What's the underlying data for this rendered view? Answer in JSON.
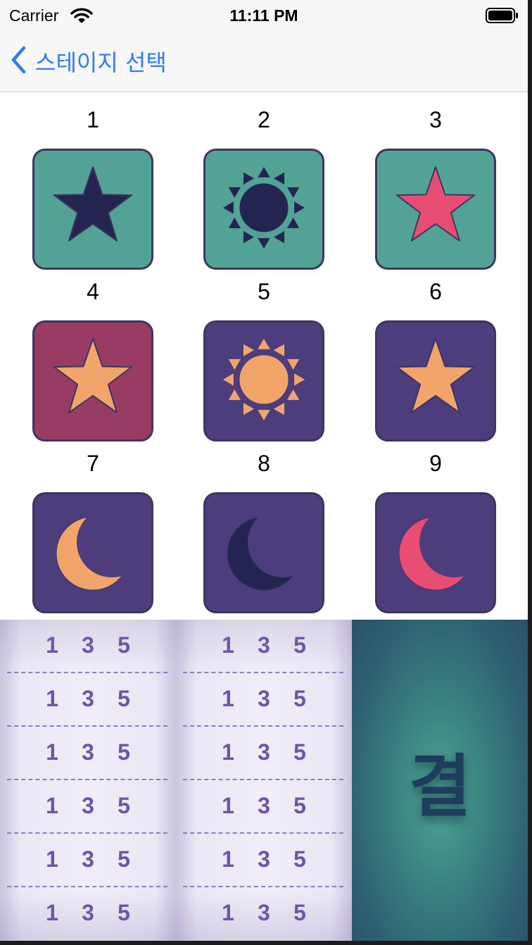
{
  "status_bar": {
    "carrier": "Carrier",
    "time": "11:11 PM"
  },
  "nav": {
    "back_label": "스테이지 선택"
  },
  "stages": [
    {
      "number": "1",
      "icon": "star-icon",
      "shape": "star",
      "bg": "#52a396",
      "fg": "#232550"
    },
    {
      "number": "2",
      "icon": "sun-icon",
      "shape": "sun",
      "bg": "#52a396",
      "fg": "#232550"
    },
    {
      "number": "3",
      "icon": "star-icon",
      "shape": "star",
      "bg": "#52a396",
      "fg": "#e84e73"
    },
    {
      "number": "4",
      "icon": "star-icon",
      "shape": "star",
      "bg": "#993c63",
      "fg": "#f2a56a"
    },
    {
      "number": "5",
      "icon": "sun-icon",
      "shape": "sun",
      "bg": "#4d3d7c",
      "fg": "#f2a56a"
    },
    {
      "number": "6",
      "icon": "star-icon",
      "shape": "star",
      "bg": "#4d3d7c",
      "fg": "#f2a56a"
    },
    {
      "number": "7",
      "icon": "moon-icon",
      "shape": "moon",
      "bg": "#4d3d7c",
      "fg": "#f2a56a"
    },
    {
      "number": "8",
      "icon": "moon-icon",
      "shape": "moon",
      "bg": "#4d3d7c",
      "fg": "#232550"
    },
    {
      "number": "9",
      "icon": "moon-icon",
      "shape": "moon",
      "bg": "#4d3d7c",
      "fg": "#e84e73"
    }
  ],
  "reels": [
    {
      "rows": [
        [
          "1",
          "3",
          "5"
        ],
        [
          "1",
          "3",
          "5"
        ],
        [
          "1",
          "3",
          "5"
        ],
        [
          "1",
          "3",
          "5"
        ],
        [
          "1",
          "3",
          "5"
        ],
        [
          "1",
          "3",
          "5"
        ]
      ]
    },
    {
      "rows": [
        [
          "1",
          "3",
          "5"
        ],
        [
          "1",
          "3",
          "5"
        ],
        [
          "1",
          "3",
          "5"
        ],
        [
          "1",
          "3",
          "5"
        ],
        [
          "1",
          "3",
          "5"
        ],
        [
          "1",
          "3",
          "5"
        ]
      ]
    }
  ],
  "result": {
    "text": "결"
  },
  "colors": {
    "accent": "#2f7bf5",
    "reel_number": "#6a55a8"
  }
}
